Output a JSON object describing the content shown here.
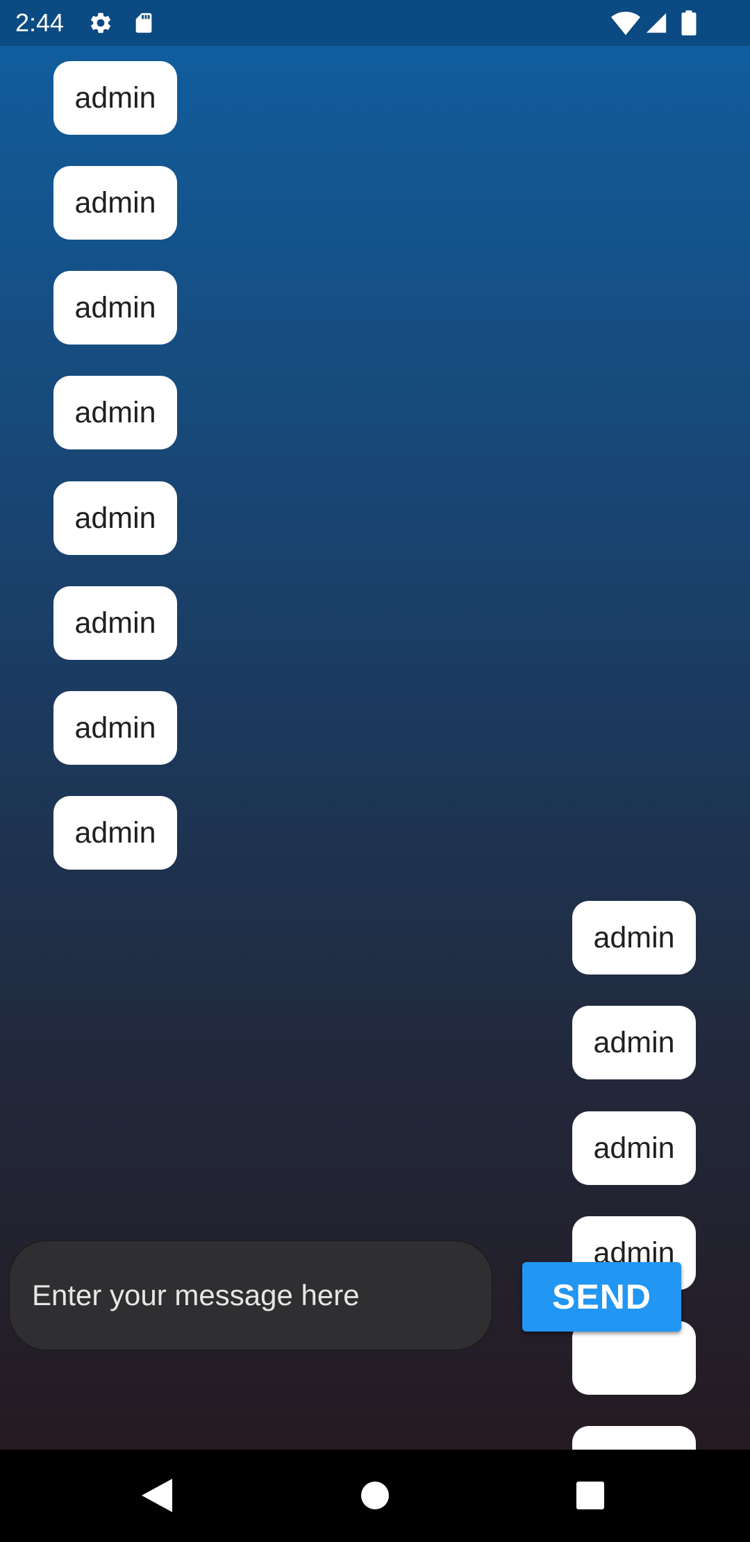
{
  "status_bar": {
    "time": "2:44",
    "icons": [
      "gear-icon",
      "sd-card-icon",
      "wifi-icon",
      "cell-signal-icon",
      "battery-icon"
    ]
  },
  "chat": {
    "messages": [
      {
        "side": "left",
        "text": "admin"
      },
      {
        "side": "left",
        "text": "admin"
      },
      {
        "side": "left",
        "text": "admin"
      },
      {
        "side": "left",
        "text": "admin"
      },
      {
        "side": "left",
        "text": "admin"
      },
      {
        "side": "left",
        "text": "admin"
      },
      {
        "side": "left",
        "text": "admin"
      },
      {
        "side": "left",
        "text": "admin"
      },
      {
        "side": "right",
        "text": "admin"
      },
      {
        "side": "right",
        "text": "admin"
      },
      {
        "side": "right",
        "text": "admin"
      },
      {
        "side": "right",
        "text": "admin"
      },
      {
        "side": "right",
        "text": ""
      },
      {
        "side": "right",
        "text": ""
      }
    ]
  },
  "composer": {
    "placeholder": "Enter your message here",
    "send_label": "SEND"
  },
  "nav_bar": {
    "buttons": [
      "back-icon",
      "home-icon",
      "recents-icon"
    ]
  },
  "colors": {
    "status_bar": "#0b4a82",
    "gradient_top": "#115d9d",
    "gradient_bottom": "#251a21",
    "send_button": "#2196f3",
    "input_background": "#2f2f31"
  }
}
